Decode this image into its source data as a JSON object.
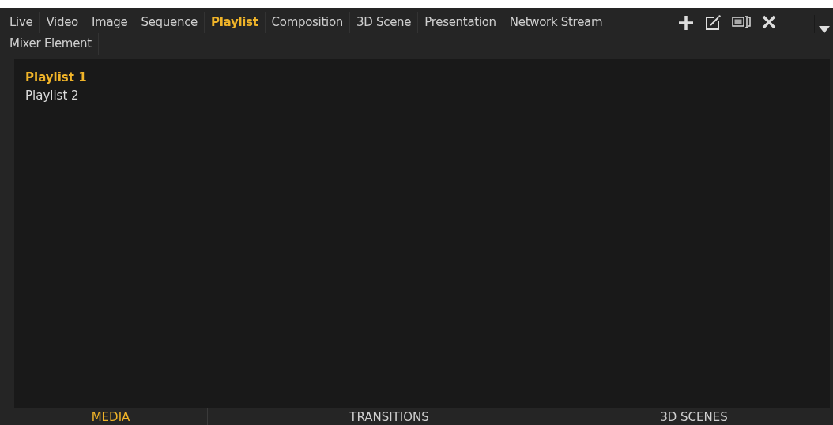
{
  "type_tabs": [
    {
      "label": "Live",
      "selected": false
    },
    {
      "label": "Video",
      "selected": false
    },
    {
      "label": "Image",
      "selected": false
    },
    {
      "label": "Sequence",
      "selected": false
    },
    {
      "label": "Playlist",
      "selected": true
    },
    {
      "label": "Composition",
      "selected": false
    },
    {
      "label": "3D Scene",
      "selected": false
    },
    {
      "label": "Presentation",
      "selected": false
    },
    {
      "label": "Network Stream",
      "selected": false
    },
    {
      "label": "Mixer Element",
      "selected": false
    }
  ],
  "playlists": [
    {
      "label": "Playlist 1",
      "selected": true
    },
    {
      "label": "Playlist 2",
      "selected": false
    }
  ],
  "bottom_tabs": [
    {
      "label": "MEDIA",
      "selected": true
    },
    {
      "label": "TRANSITIONS",
      "selected": false
    },
    {
      "label": "3D SCENES",
      "selected": false
    }
  ]
}
